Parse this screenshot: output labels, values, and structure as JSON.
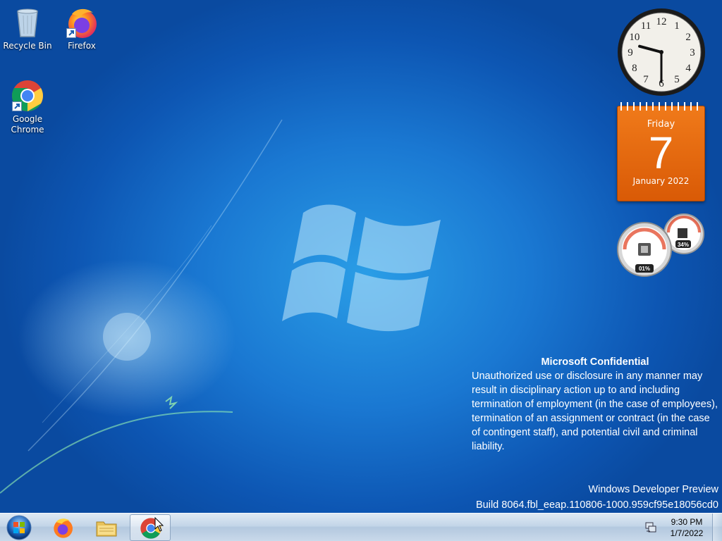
{
  "desktop": {
    "icons": [
      {
        "label": "Recycle Bin",
        "icon": "recycle-bin-icon"
      },
      {
        "label": "Firefox",
        "icon": "firefox-icon"
      },
      {
        "label": "Google Chrome",
        "icon": "chrome-icon"
      }
    ]
  },
  "gadgets": {
    "clock": {
      "hour": 9,
      "minute": 30,
      "numerals": [
        "12",
        "1",
        "2",
        "3",
        "4",
        "5",
        "6",
        "7",
        "8",
        "9",
        "10",
        "11"
      ]
    },
    "calendar": {
      "day": "Friday",
      "date": "7",
      "month_year": "January 2022"
    },
    "meter": {
      "cpu": "01%",
      "memory": "34%"
    }
  },
  "notice": {
    "title": "Microsoft Confidential",
    "body": "Unauthorized use or disclosure in any manner may result in disciplinary action up to and including termination of employment (in the case of employees), termination of an assignment or contract (in the case of contingent staff), and potential civil and criminal liability."
  },
  "build": {
    "line1": "Windows Developer Preview",
    "line2": "Build 8064.fbl_eeap.110806-1000.959cf95e18056cd0"
  },
  "taskbar": {
    "items": [
      {
        "name": "start",
        "icon": "windows-orb-icon"
      },
      {
        "name": "firefox",
        "icon": "firefox-icon"
      },
      {
        "name": "explorer",
        "icon": "folder-icon"
      },
      {
        "name": "chrome",
        "icon": "chrome-icon",
        "active": true
      }
    ],
    "time": "9:30 PM",
    "date": "1/7/2022"
  },
  "colors": {
    "calendar_orange": "#e56a10",
    "desktop_blue": "#1a78d2"
  }
}
